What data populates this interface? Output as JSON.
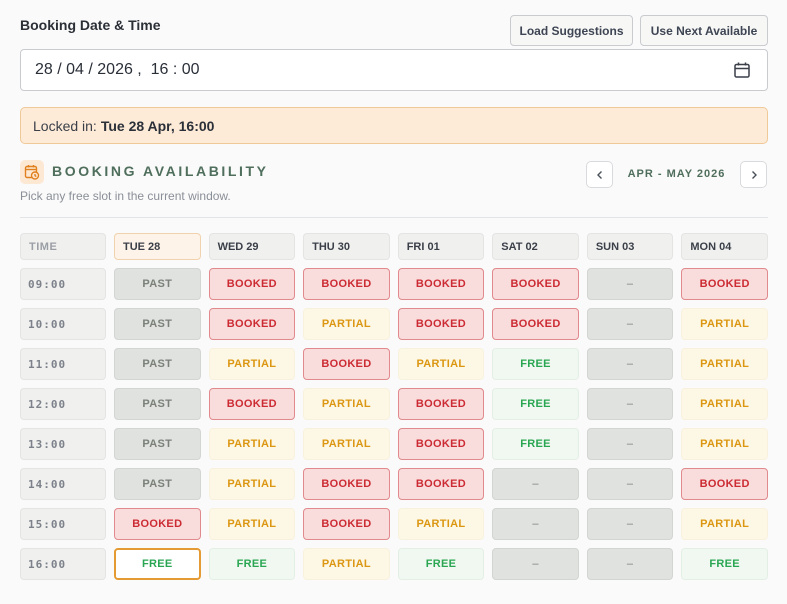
{
  "form": {
    "label": "Booking Date & Time",
    "load_button": "Load Suggestions",
    "next_button": "Use Next Available",
    "datetime_value": "28 / 04 / 2026 ,  16 : 00",
    "locked_prefix": "Locked in:",
    "locked_value": "Tue 28 Apr, 16:00"
  },
  "availability": {
    "title": "BOOKING AVAILABILITY",
    "subtitle": "Pick any free slot in the current window.",
    "range_label": "APR - MAY 2026",
    "time_header": "TIME",
    "days": [
      "TUE 28",
      "WED 29",
      "THU 30",
      "FRI 01",
      "SAT 02",
      "SUN 03",
      "MON 04"
    ],
    "rows": [
      {
        "time": "09:00",
        "slots": [
          "PAST",
          "BOOKED",
          "BOOKED",
          "BOOKED",
          "BOOKED",
          "–",
          "BOOKED"
        ]
      },
      {
        "time": "10:00",
        "slots": [
          "PAST",
          "BOOKED",
          "PARTIAL",
          "BOOKED",
          "BOOKED",
          "–",
          "PARTIAL"
        ]
      },
      {
        "time": "11:00",
        "slots": [
          "PAST",
          "PARTIAL",
          "BOOKED",
          "PARTIAL",
          "FREE",
          "–",
          "PARTIAL"
        ]
      },
      {
        "time": "12:00",
        "slots": [
          "PAST",
          "BOOKED",
          "PARTIAL",
          "BOOKED",
          "FREE",
          "–",
          "PARTIAL"
        ]
      },
      {
        "time": "13:00",
        "slots": [
          "PAST",
          "PARTIAL",
          "PARTIAL",
          "BOOKED",
          "FREE",
          "–",
          "PARTIAL"
        ]
      },
      {
        "time": "14:00",
        "slots": [
          "PAST",
          "PARTIAL",
          "BOOKED",
          "BOOKED",
          "–",
          "–",
          "BOOKED"
        ]
      },
      {
        "time": "15:00",
        "slots": [
          "BOOKED",
          "PARTIAL",
          "BOOKED",
          "PARTIAL",
          "–",
          "–",
          "PARTIAL"
        ]
      },
      {
        "time": "16:00",
        "slots": [
          "FREE",
          "FREE",
          "PARTIAL",
          "FREE",
          "–",
          "–",
          "FREE"
        ]
      }
    ],
    "selected": {
      "day": "TUE 28",
      "time": "16:00"
    }
  },
  "colors": {
    "accent": "#e59b33",
    "booked": "#cc2b33",
    "partial": "#dc9712",
    "free": "#2aa653",
    "heading": "#4f6e5c"
  },
  "icons": {
    "date_picker": "calendar-icon",
    "section": "calendar-clock-icon",
    "prev": "chevron-left-icon",
    "next": "chevron-right-icon"
  }
}
